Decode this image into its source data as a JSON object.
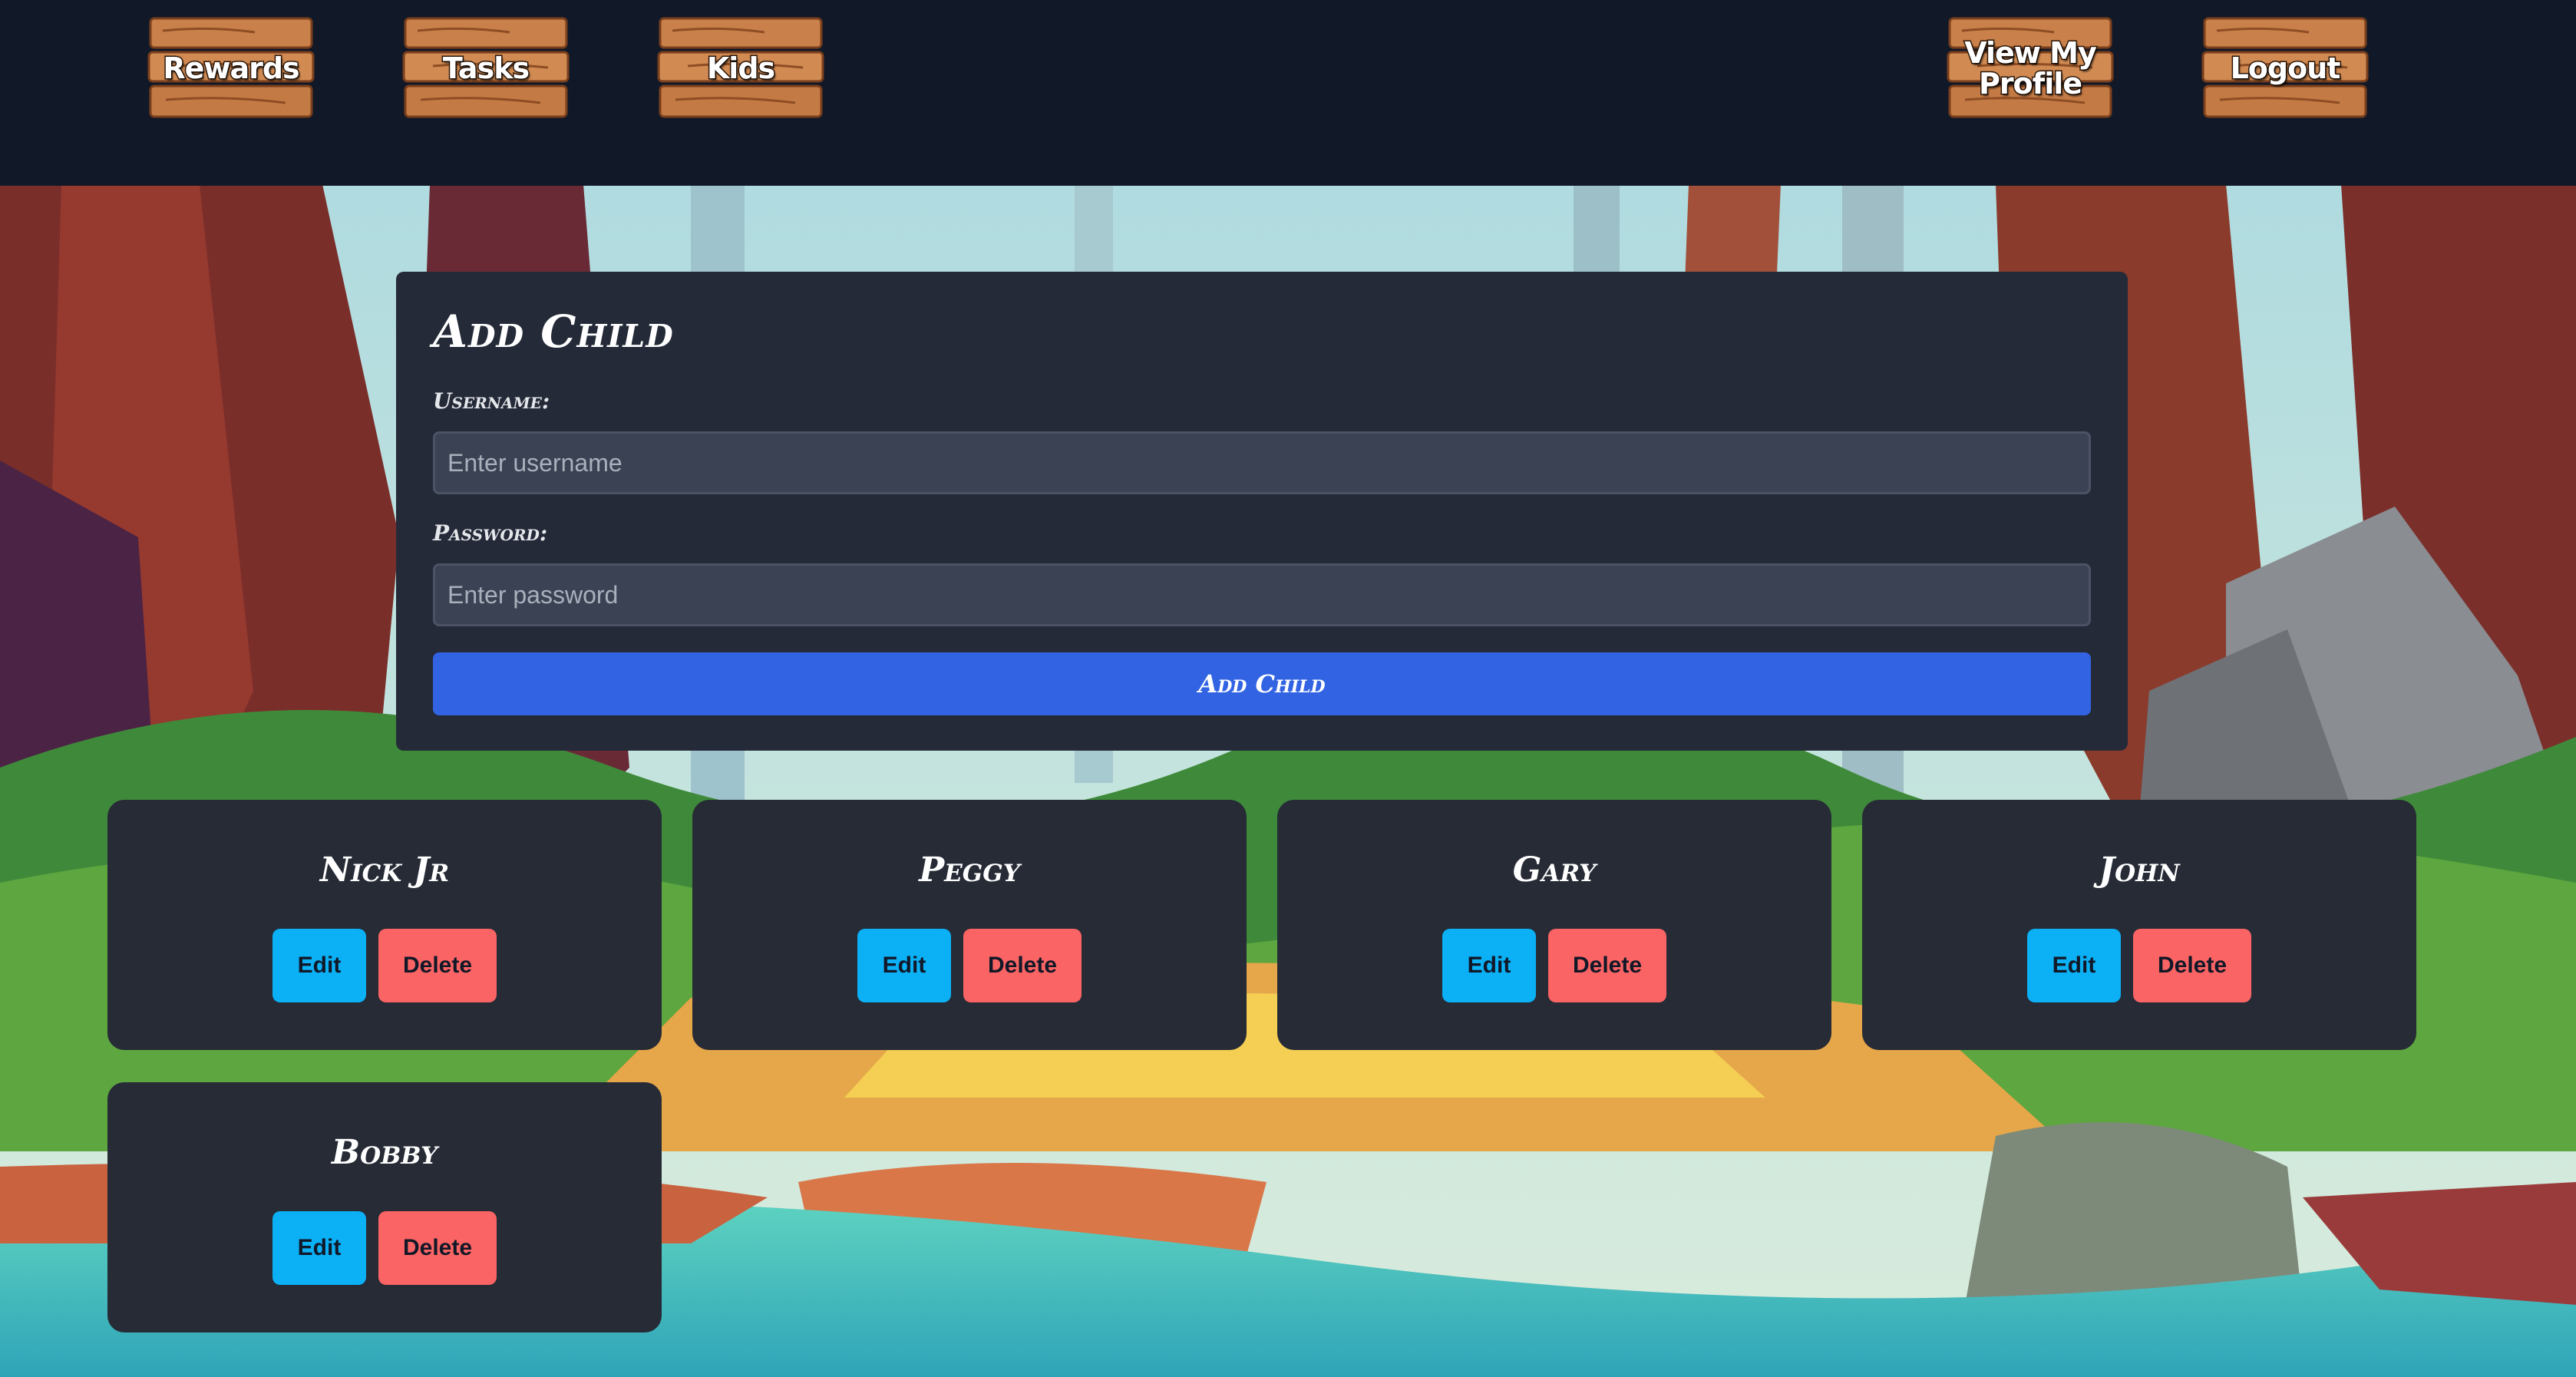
{
  "nav": {
    "items": [
      {
        "label": "Rewards",
        "name": "nav-rewards"
      },
      {
        "label": "Tasks",
        "name": "nav-tasks"
      },
      {
        "label": "Kids",
        "name": "nav-kids"
      },
      {
        "label": "View My Profile",
        "name": "nav-view-my-profile"
      },
      {
        "label": "Logout",
        "name": "nav-logout"
      }
    ]
  },
  "add_child": {
    "title": "Add Child",
    "username_label": "Username:",
    "username_placeholder": "Enter username",
    "username_value": "",
    "password_label": "Password:",
    "password_placeholder": "Enter password",
    "password_value": "",
    "submit_label": "Add Child"
  },
  "kids": [
    {
      "name": "Nick Jr",
      "edit_label": "Edit",
      "delete_label": "Delete"
    },
    {
      "name": "Peggy",
      "edit_label": "Edit",
      "delete_label": "Delete"
    },
    {
      "name": "Gary",
      "edit_label": "Edit",
      "delete_label": "Delete"
    },
    {
      "name": "John",
      "edit_label": "Edit",
      "delete_label": "Delete"
    },
    {
      "name": "Bobby",
      "edit_label": "Edit",
      "delete_label": "Delete"
    }
  ],
  "colors": {
    "nav_background": "#111827",
    "panel_background": "#242a38",
    "card_background": "#262b36",
    "primary_button": "#3263e3",
    "edit_button": "#0bb0f5",
    "delete_button": "#fb6464",
    "plank_wood": "#c9804a"
  }
}
